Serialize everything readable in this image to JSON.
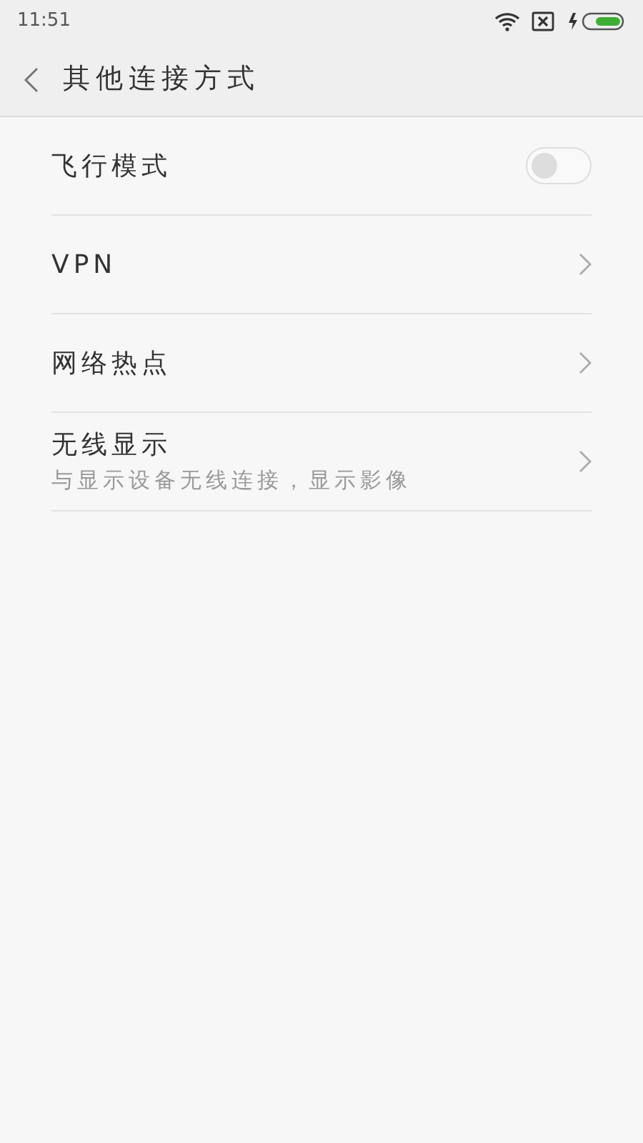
{
  "status_bar": {
    "time": "11:51"
  },
  "header": {
    "title": "其他连接方式"
  },
  "items": [
    {
      "kind": "toggle",
      "label": "飞行模式",
      "on": false
    },
    {
      "kind": "link",
      "label": "VPN"
    },
    {
      "kind": "link",
      "label": "网络热点"
    },
    {
      "kind": "link",
      "label": "无线显示",
      "subtitle": "与显示设备无线连接，显示影像"
    }
  ]
}
